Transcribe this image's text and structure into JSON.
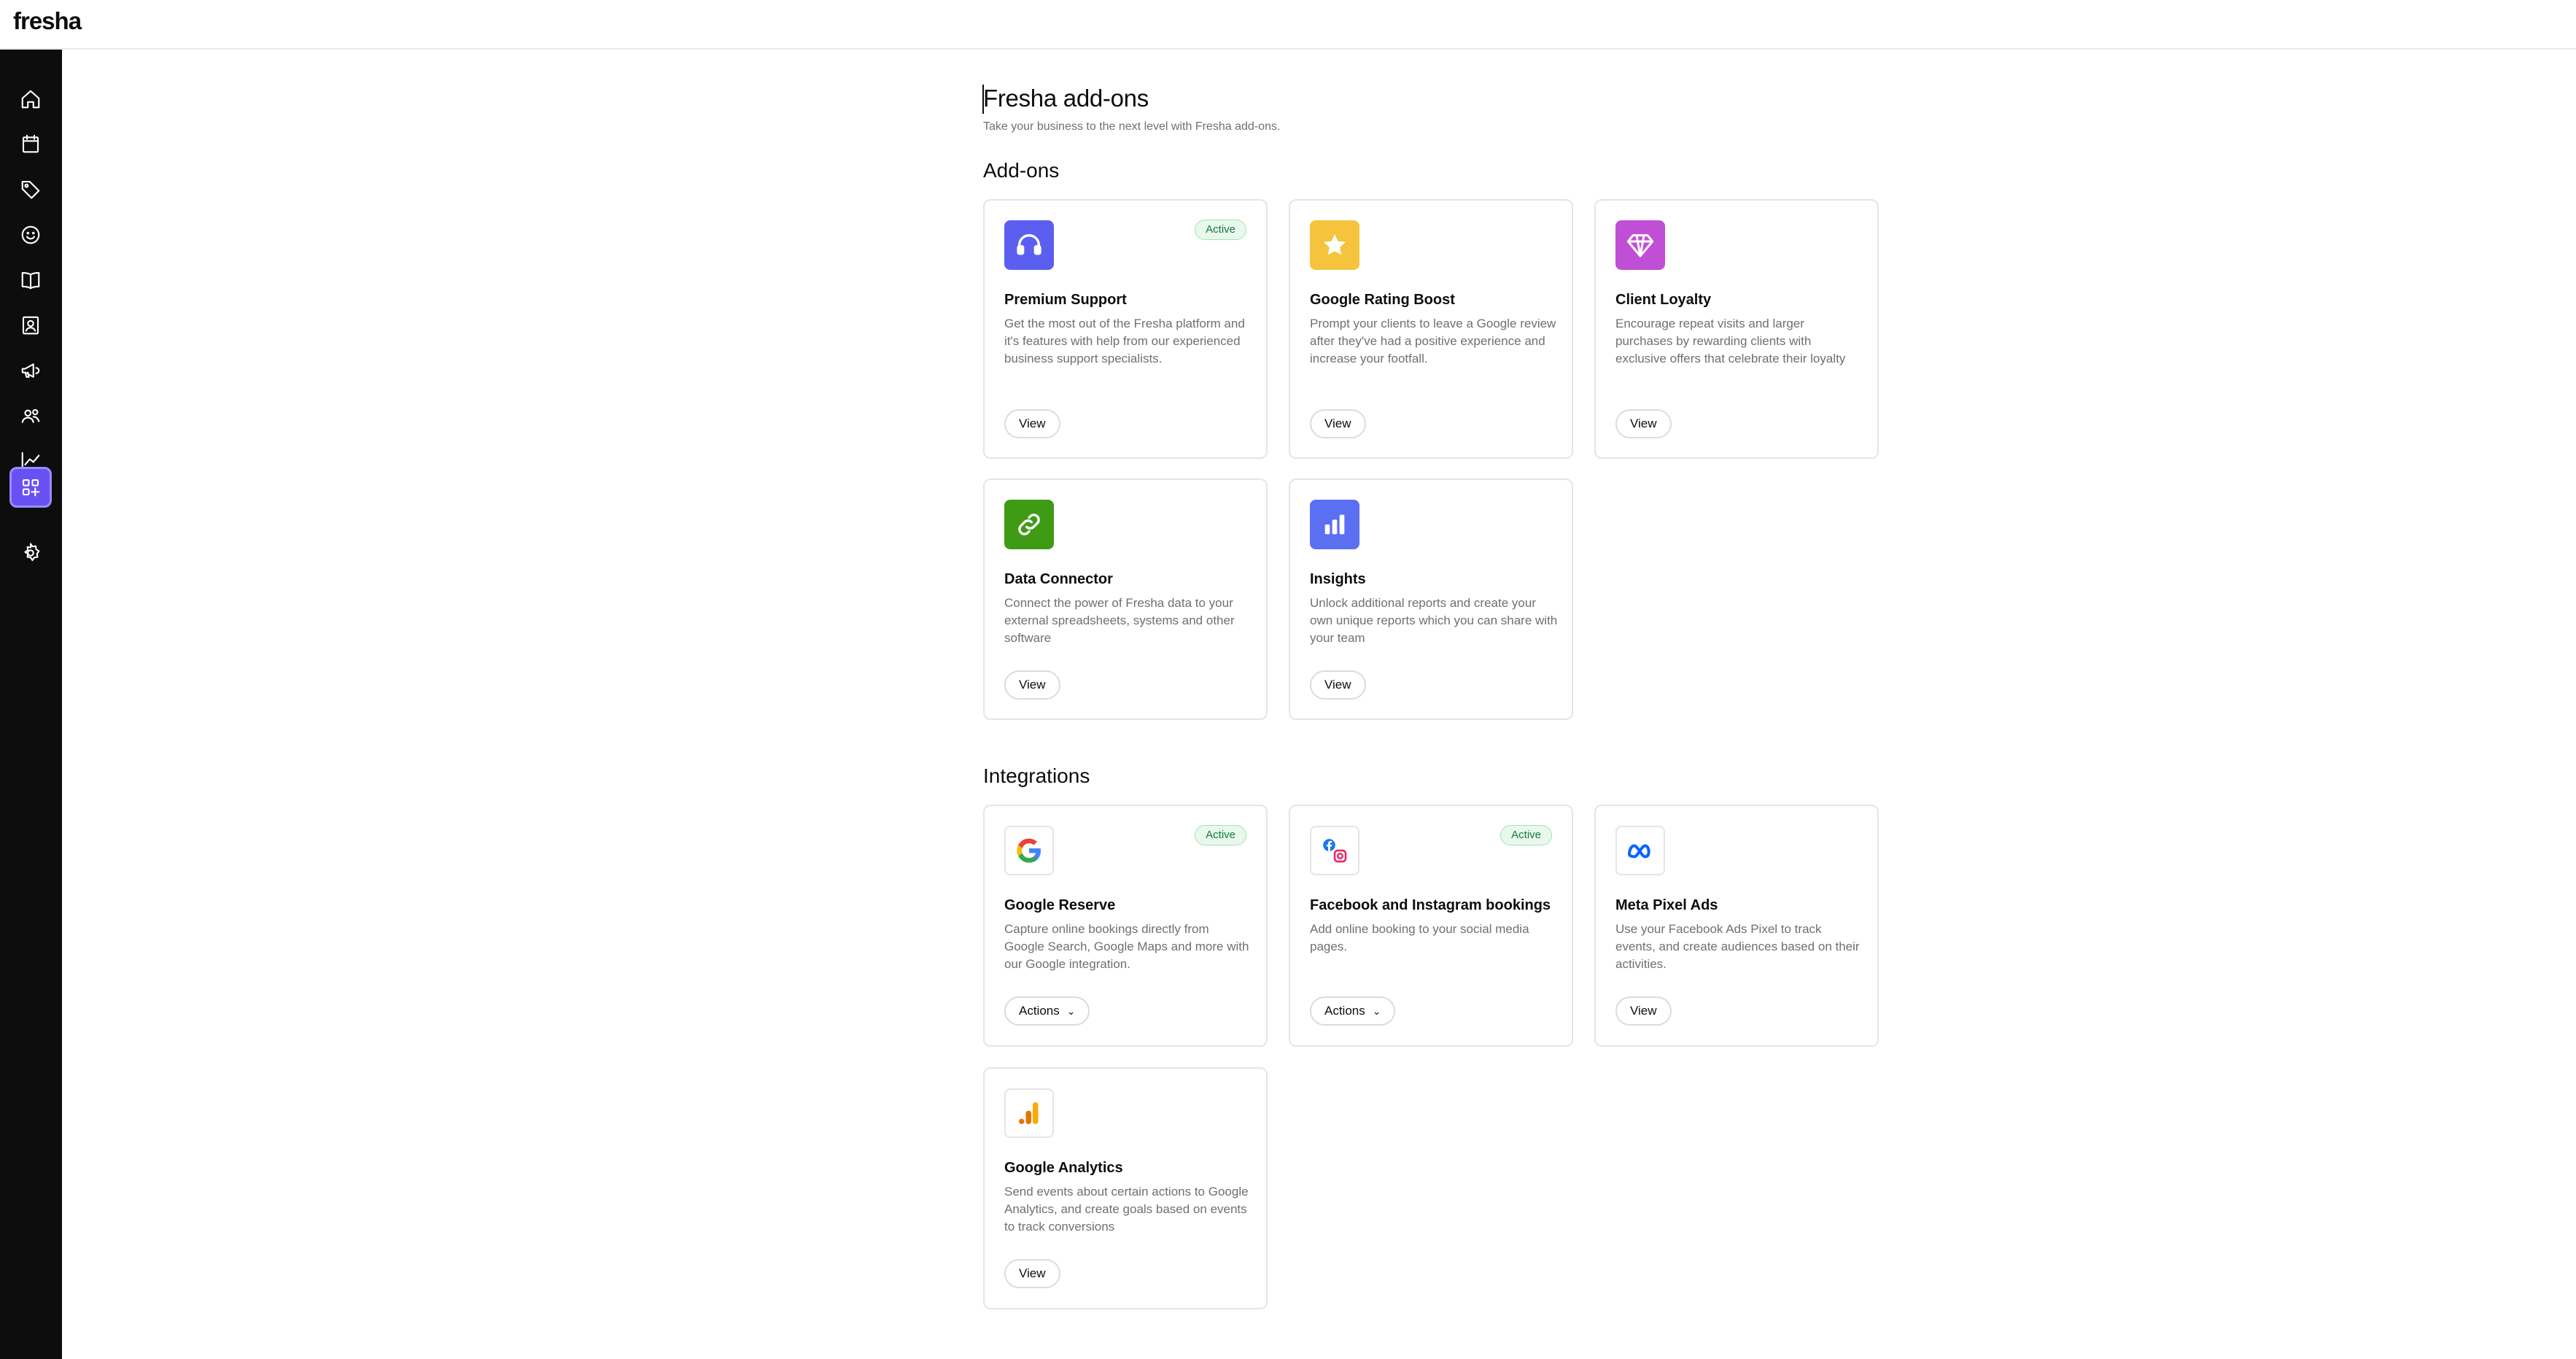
{
  "app": {
    "logo": "fresha"
  },
  "sidebar": {
    "items": [
      {
        "icon": "home-icon"
      },
      {
        "icon": "calendar-icon"
      },
      {
        "icon": "tag-icon"
      },
      {
        "icon": "smile-icon"
      },
      {
        "icon": "book-icon"
      },
      {
        "icon": "contact-card-icon"
      },
      {
        "icon": "megaphone-icon"
      },
      {
        "icon": "team-icon"
      },
      {
        "icon": "chart-icon"
      },
      {
        "icon": "add-ons-icon",
        "active": true
      },
      {
        "icon": "gear-icon"
      }
    ]
  },
  "header": {
    "title": "Fresha add-ons",
    "subtitle": "Take your business to the next level with Fresha add-ons."
  },
  "addons": {
    "title": "Add-ons",
    "cards": [
      {
        "title": "Premium Support",
        "badge": "Active",
        "description": "Get the most out of the Fresha platform and it's features with help from our experienced business support specialists.",
        "button": "View",
        "icon": "headset-icon",
        "icon_color": "#5b5ff0"
      },
      {
        "title": "Google Rating Boost",
        "badge": "",
        "description": "Prompt your clients to leave a Google review after they've had a positive experience and increase your footfall.",
        "button": "View",
        "icon": "star-icon",
        "icon_color": "#f6c33d"
      },
      {
        "title": "Client Loyalty",
        "badge": "",
        "description": "Encourage repeat visits and larger purchases by rewarding clients with exclusive offers that celebrate their loyalty",
        "button": "View",
        "icon": "diamond-icon",
        "icon_color": "#c14fd6"
      },
      {
        "title": "Data Connector",
        "badge": "",
        "description": "Connect the power of Fresha data to your external spreadsheets, systems and other software",
        "button": "View",
        "icon": "link-icon",
        "icon_color": "#3f9a14"
      },
      {
        "title": "Insights",
        "badge": "",
        "description": "Unlock additional reports and create your own unique reports which you can share with your team",
        "button": "View",
        "icon": "bar-chart-icon",
        "icon_color": "#5b6ff2"
      }
    ]
  },
  "integrations": {
    "title": "Integrations",
    "cards": [
      {
        "title": "Google Reserve",
        "badge": "Active",
        "description": "Capture online bookings directly from Google Search, Google Maps and more with our Google integration.",
        "button": "Actions",
        "icon": "google-icon"
      },
      {
        "title": "Facebook and Instagram bookings",
        "badge": "Active",
        "description": "Add online booking to your social media pages.",
        "button": "Actions",
        "icon": "facebook-instagram-icon"
      },
      {
        "title": "Meta Pixel Ads",
        "badge": "",
        "description": "Use your Facebook Ads Pixel to track events, and create audiences based on their activities.",
        "button": "View",
        "icon": "meta-icon"
      },
      {
        "title": "Google Analytics",
        "badge": "",
        "description": "Send events about certain actions to Google Analytics, and create goals based on events to track conversions",
        "button": "View",
        "icon": "google-analytics-icon"
      }
    ]
  }
}
